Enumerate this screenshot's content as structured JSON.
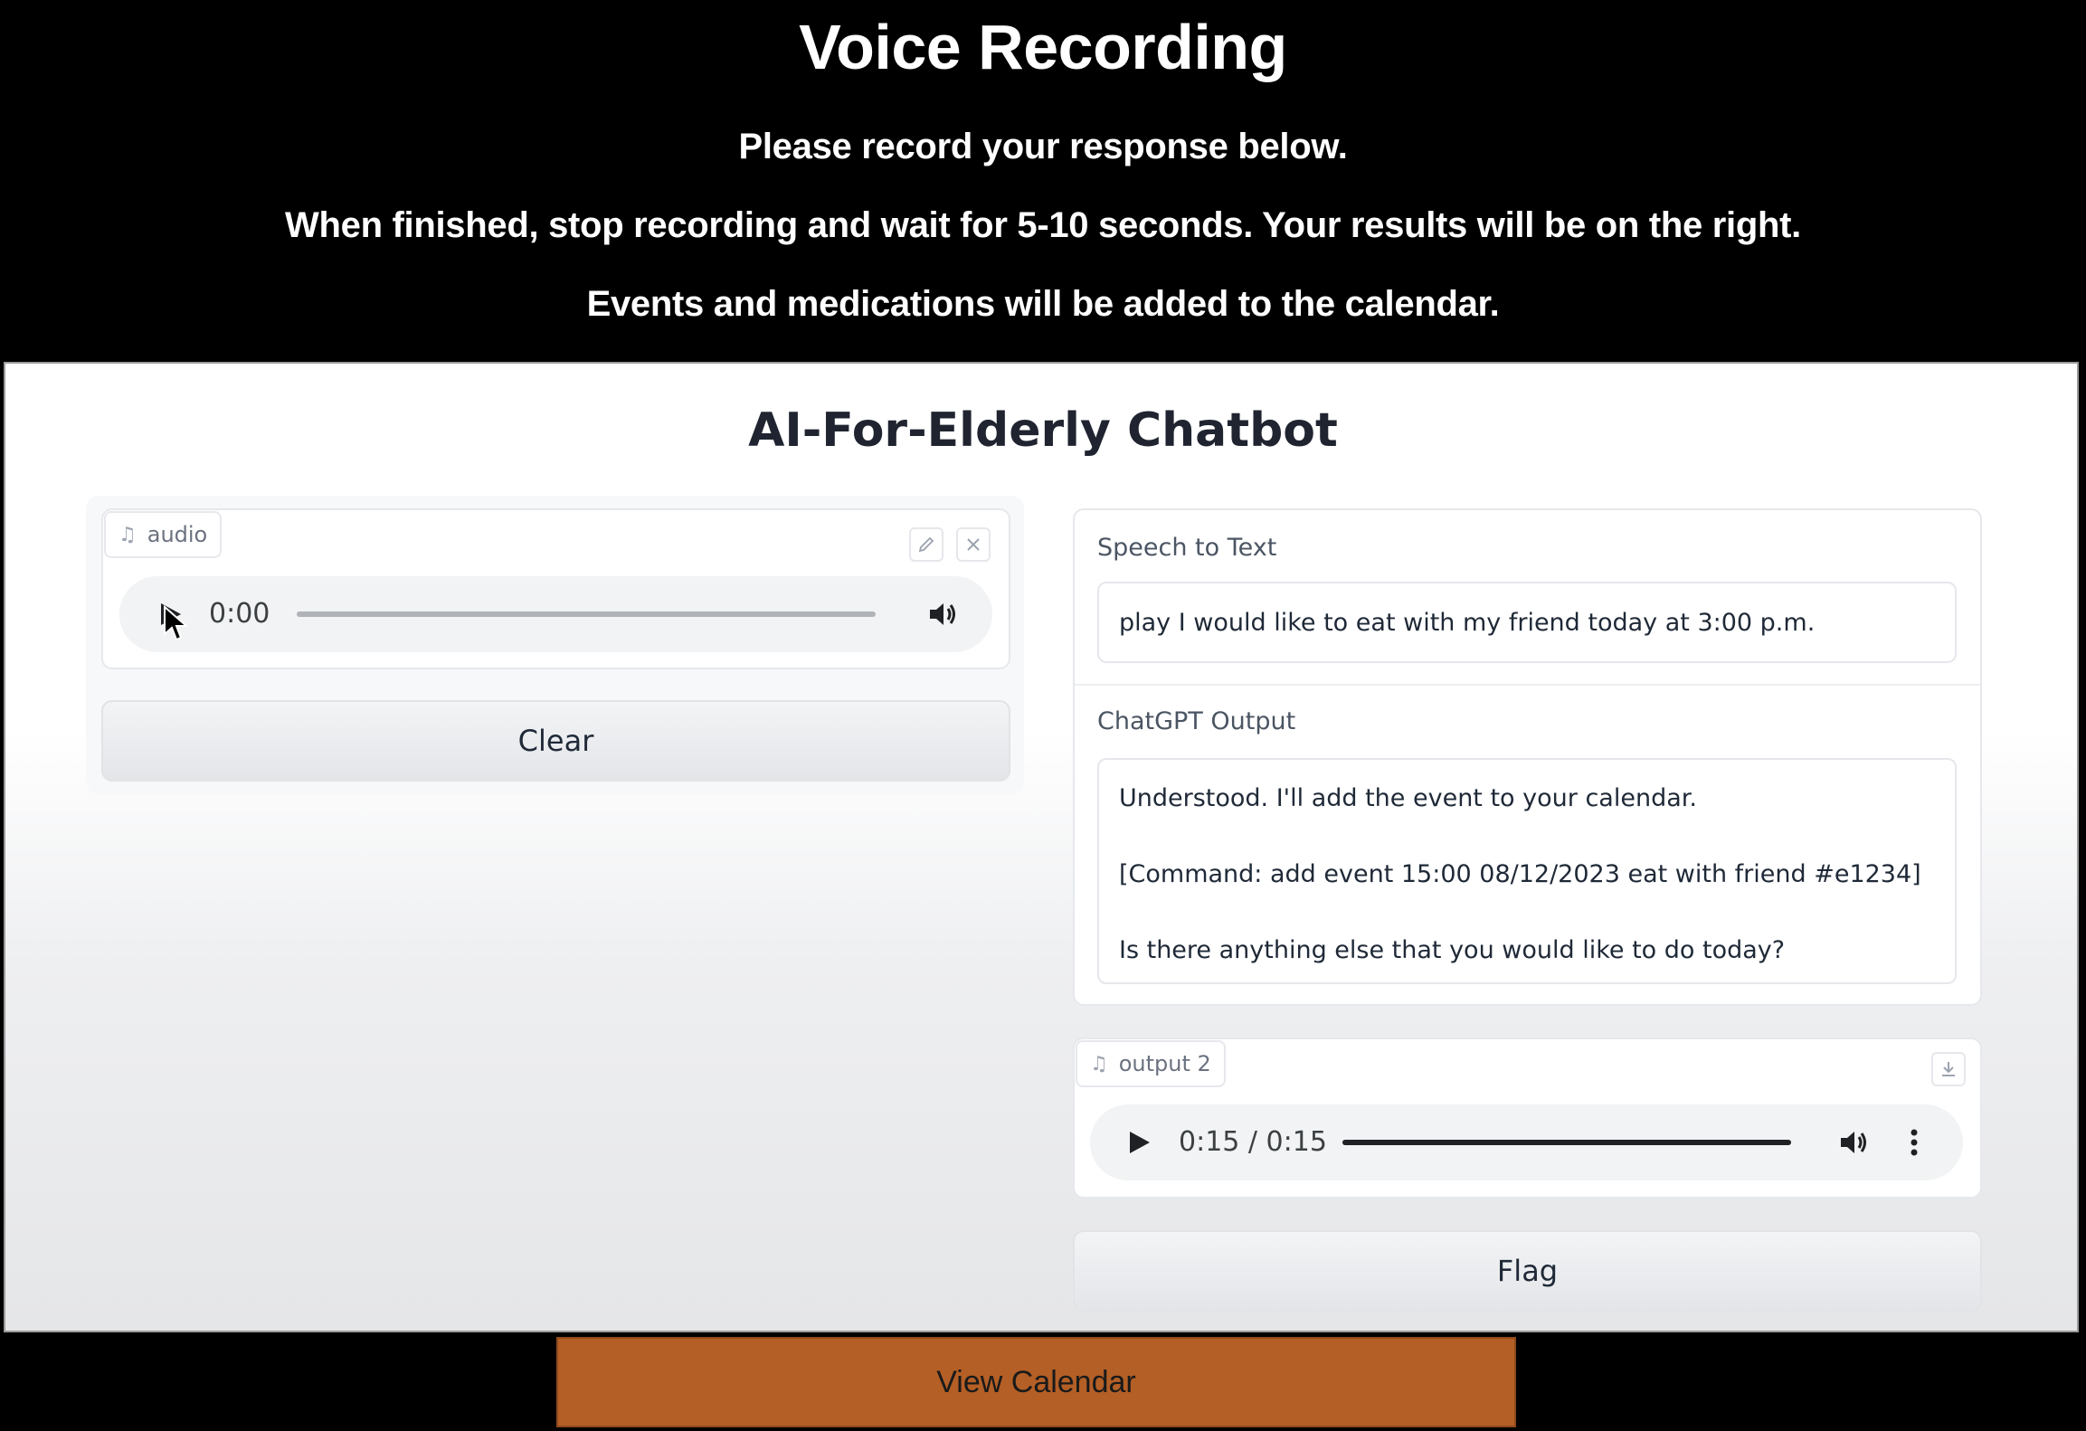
{
  "header": {
    "title": "Voice Recording",
    "instruction_1": "Please record your response below.",
    "instruction_2": "When finished, stop recording and wait for 5-10 seconds. Your results will be on the right.",
    "instruction_3": "Events and medications will be added to the calendar."
  },
  "app": {
    "title": "AI-For-Elderly Chatbot",
    "audio_input": {
      "label": "audio",
      "label_icon": "music-note-icon",
      "edit_icon": "pencil-icon",
      "close_icon": "close-icon",
      "time": "0:00",
      "progress": 0
    },
    "clear_button": "Clear",
    "speech_to_text": {
      "label": "Speech to Text",
      "value": "play I would like to eat with my friend today at 3:00 p.m."
    },
    "chatgpt_output": {
      "label": "ChatGPT Output",
      "lines": [
        "Understood. I'll add the event to your calendar.",
        "[Command: add event 15:00 08/12/2023 eat with friend #e1234]",
        "Is there anything else that you would like to do today?"
      ]
    },
    "audio_output": {
      "label": "output 2",
      "download_icon": "download-icon",
      "time": "0:15 / 0:15",
      "progress": 1.0
    },
    "flag_button": "Flag"
  },
  "view_calendar_button": "View Calendar",
  "colors": {
    "background": "#000000",
    "calendar_button": "#b45f26"
  }
}
